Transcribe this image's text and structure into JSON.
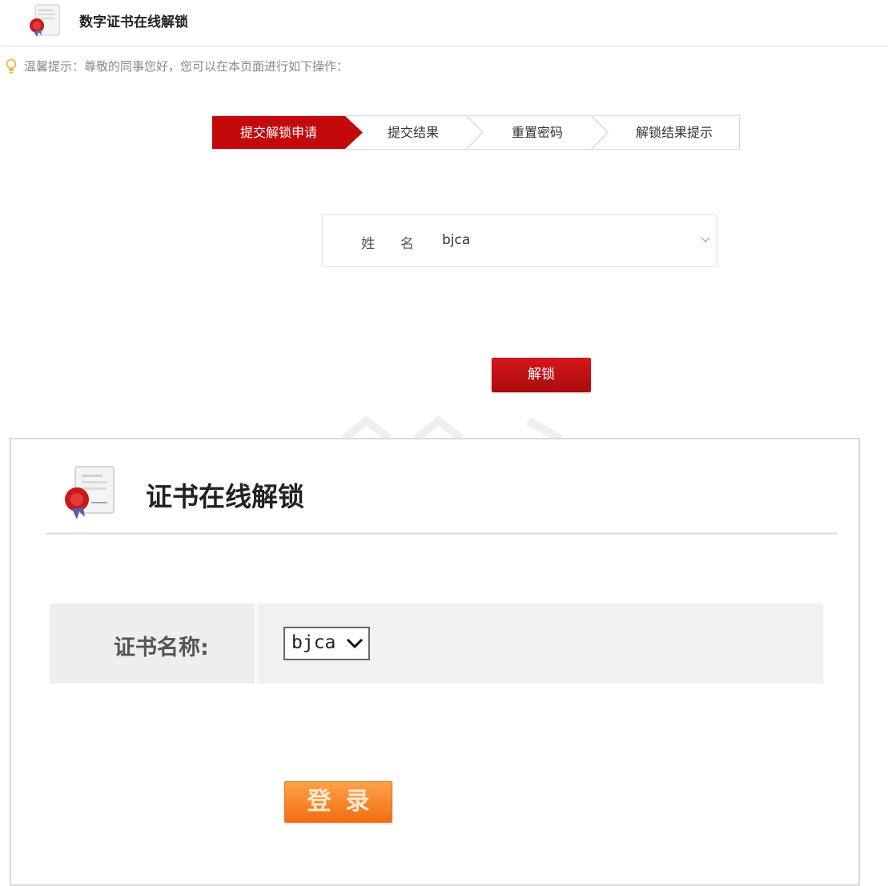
{
  "header": {
    "title": "数字证书在线解锁",
    "icon": "certificate-seal-icon"
  },
  "tip": {
    "text": "温馨提示：尊敬的同事您好，您可以在本页面进行如下操作：",
    "icon": "lightbulb-icon"
  },
  "steps": [
    {
      "label": "提交解锁申请",
      "active": true
    },
    {
      "label": "提交结果",
      "active": false
    },
    {
      "label": "重置密码",
      "active": false
    },
    {
      "label": "解锁结果提示",
      "active": false
    }
  ],
  "name_field": {
    "label_1": "姓",
    "label_2": "名",
    "value": "bjca"
  },
  "unlock_button": "解锁",
  "panel": {
    "title": "证书在线解锁",
    "cert_label": "证书名称:",
    "cert_value": "bjca",
    "login_button": "登录"
  },
  "colors": {
    "brand_red": "#c3090c",
    "login_orange": "#f5812a"
  }
}
